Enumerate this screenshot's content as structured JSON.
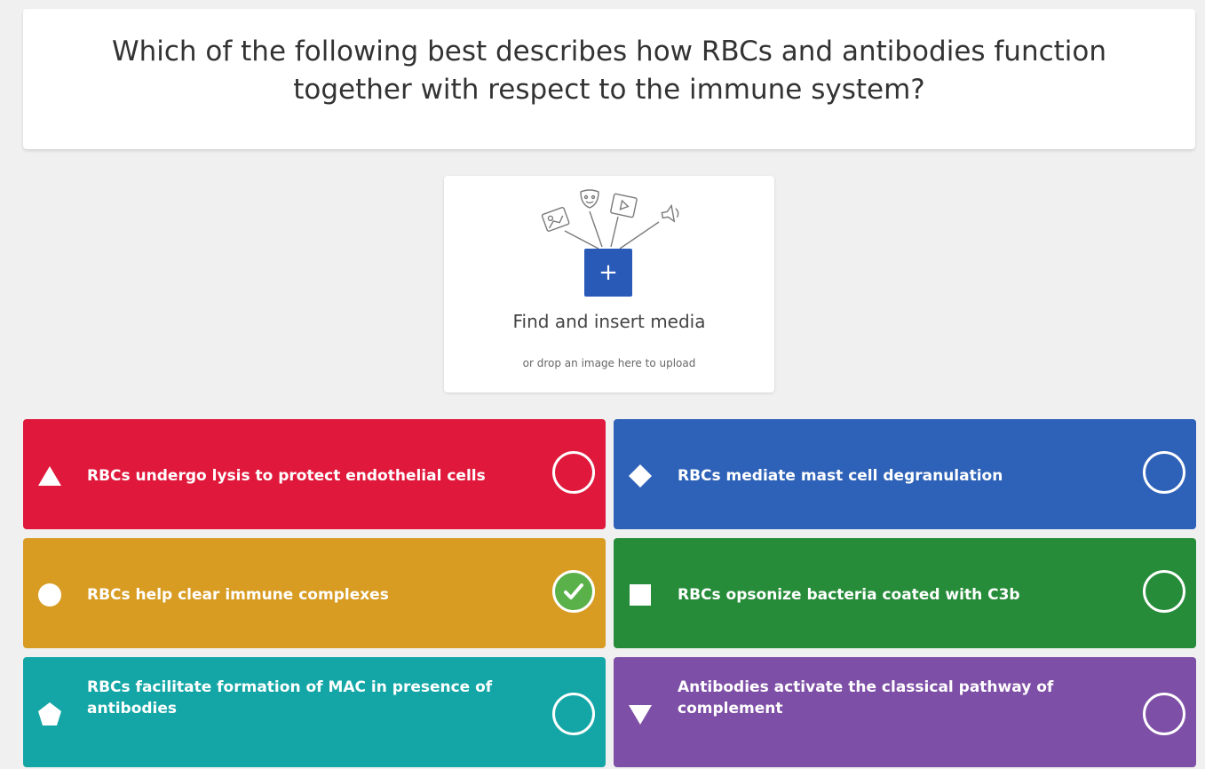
{
  "question": {
    "text": "Which of the following best describes how RBCs and antibodies function together with respect to the immune system?"
  },
  "media": {
    "title": "Find and insert media",
    "subtitle": "or drop an image here to upload",
    "add_icon": "+",
    "illustration_icons": [
      "image-icon",
      "mask-icon",
      "video-icon",
      "audio-icon"
    ]
  },
  "answers": [
    {
      "shape": "triangle-icon",
      "text": "RBCs undergo lysis to protect endothelial cells",
      "color": "#e0193c",
      "selected": false
    },
    {
      "shape": "diamond-icon",
      "text": "RBCs mediate mast cell degranulation",
      "color": "#2e62b8",
      "selected": false
    },
    {
      "shape": "circle-icon",
      "text": "RBCs help clear immune complexes",
      "color": "#d89c23",
      "selected": true
    },
    {
      "shape": "square-icon",
      "text": "RBCs opsonize bacteria coated with C3b",
      "color": "#268c39",
      "selected": false
    },
    {
      "shape": "pentagon-icon",
      "text": "RBCs facilitate formation of MAC in presence of antibodies",
      "color": "#14a6a6",
      "selected": false
    },
    {
      "shape": "down-triangle-icon",
      "text": "Antibodies activate the classical pathway of complement",
      "color": "#7e4fa6",
      "selected": false
    }
  ],
  "colors": {
    "background": "#f0f0f0",
    "card": "#ffffff",
    "primary_button": "#2a5ab8",
    "check": "#5ab14a"
  }
}
